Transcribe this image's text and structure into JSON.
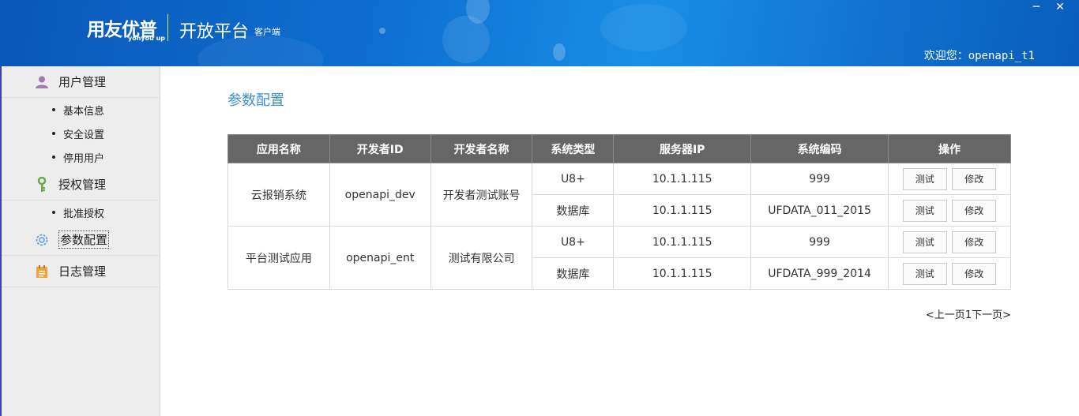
{
  "header": {
    "brand": "用友优普",
    "brand_sub": "yonyou up",
    "title": "开放平台",
    "title_sub": "客户端",
    "minimize": "─",
    "close": "✕",
    "welcome": "欢迎您：openapi_t1"
  },
  "colors": {
    "header_blue": "#0d6fd0",
    "sidebar_bg": "#ededed",
    "table_header": "#666666",
    "title_blue": "#3a8fd6"
  },
  "sidebar": {
    "groups": [
      {
        "label": "用户管理",
        "icon": "user-icon",
        "items": [
          "基本信息",
          "安全设置",
          "停用用户"
        ]
      },
      {
        "label": "授权管理",
        "icon": "key-icon",
        "items": [
          "批准授权"
        ]
      },
      {
        "label": "参数配置",
        "icon": "gear-icon",
        "items": [],
        "active": true
      },
      {
        "label": "日志管理",
        "icon": "log-icon",
        "items": []
      }
    ]
  },
  "main": {
    "title": "参数配置",
    "columns": [
      "应用名称",
      "开发者ID",
      "开发者名称",
      "系统类型",
      "服务器IP",
      "系统编码",
      "操作"
    ],
    "apps": [
      {
        "name": "云报销系统",
        "dev_id": "openapi_dev",
        "dev_name": "开发者测试账号",
        "rows": [
          {
            "type": "U8+",
            "ip": "10.1.1.115",
            "code": "999"
          },
          {
            "type": "数据库",
            "ip": "10.1.1.115",
            "code": "UFDATA_011_2015"
          }
        ]
      },
      {
        "name": "平台测试应用",
        "dev_id": "openapi_ent",
        "dev_name": "测试有限公司",
        "rows": [
          {
            "type": "U8+",
            "ip": "10.1.1.115",
            "code": "999"
          },
          {
            "type": "数据库",
            "ip": "10.1.1.115",
            "code": "UFDATA_999_2014"
          }
        ]
      }
    ],
    "btn_test": "测试",
    "btn_edit": "修改",
    "pager": {
      "prev": "<上一页",
      "page": "1",
      "next": "下一页>"
    }
  }
}
